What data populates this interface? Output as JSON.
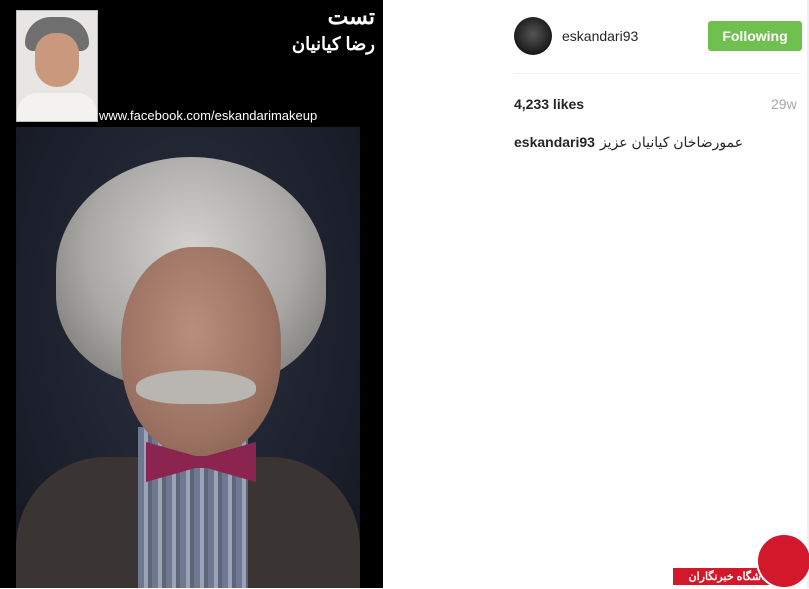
{
  "post": {
    "image_title": "تست",
    "image_subtitle": "رضا کیانیان",
    "image_url_text": "www.facebook.com/eskandarimakeup"
  },
  "header": {
    "username": "eskandari93",
    "follow_label": "Following",
    "follow_color": "#70c050"
  },
  "stats": {
    "likes": "4,233 likes",
    "time_ago": "29w"
  },
  "caption": {
    "user": "eskandari93",
    "text": "عمورضاخان کیانیان عزیز"
  },
  "watermark": {
    "text": "باشگاه خبرنگاران",
    "color": "#d3182b"
  }
}
